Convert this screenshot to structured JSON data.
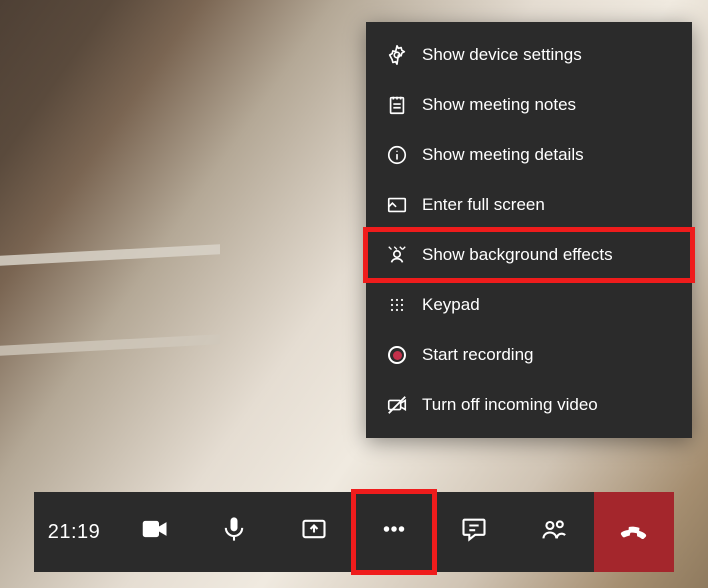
{
  "menu": {
    "items": [
      {
        "label": "Show device settings"
      },
      {
        "label": "Show meeting notes"
      },
      {
        "label": "Show meeting details"
      },
      {
        "label": "Enter full screen"
      },
      {
        "label": "Show background effects"
      },
      {
        "label": "Keypad"
      },
      {
        "label": "Start recording"
      },
      {
        "label": "Turn off incoming video"
      }
    ]
  },
  "toolbar": {
    "time": "21:19"
  }
}
